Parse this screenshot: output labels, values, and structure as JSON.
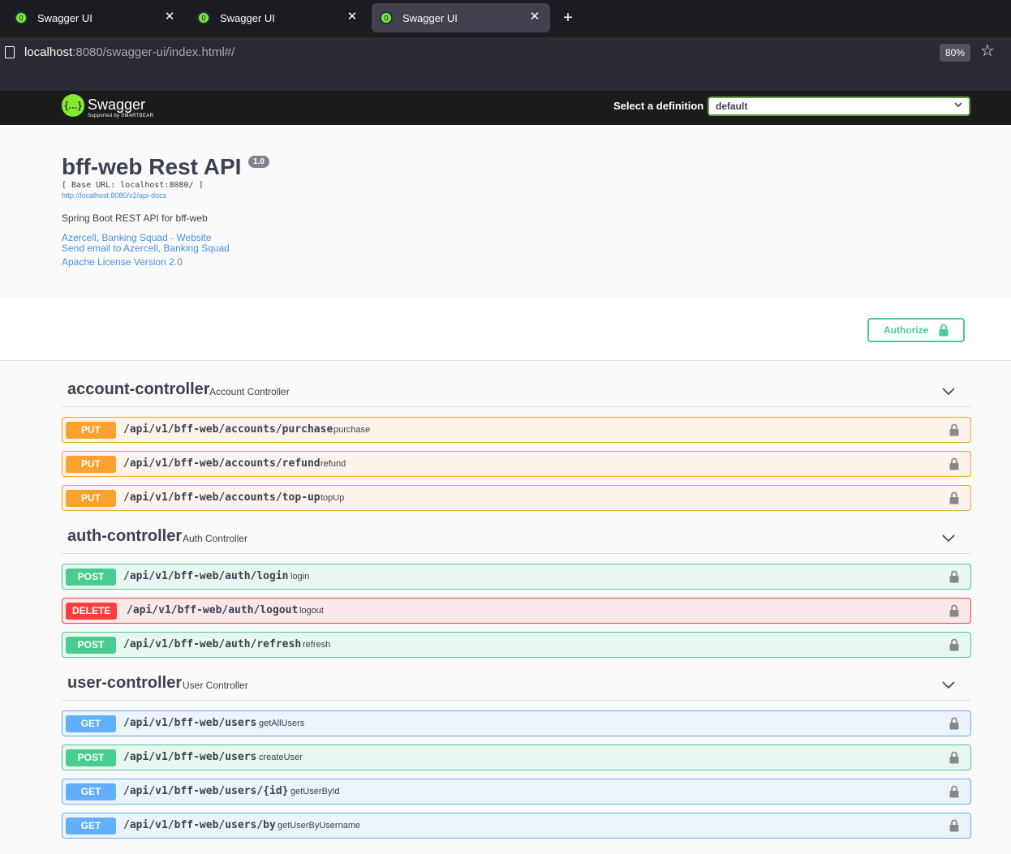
{
  "browser": {
    "tabs": [
      {
        "title": "Swagger UI"
      },
      {
        "title": "Swagger UI"
      },
      {
        "title": "Swagger UI",
        "active": true
      }
    ],
    "url_host": "localhost",
    "url_path": ":8080/swagger-ui/index.html#/",
    "zoom": "80%",
    "new_tab": "+",
    "close_glyph": "✕",
    "star_glyph": "☆"
  },
  "topbar": {
    "logo_text": "Swagger",
    "logo_sub": "Supported by SMARTBEAR",
    "definition_label": "Select a definition",
    "definition_value": "default",
    "chevron": "⌄"
  },
  "info": {
    "title": "bff-web Rest API",
    "version": "1.0",
    "base_url": "[ Base URL: localhost:8080/ ]",
    "api_docs_link": "http://localhost:8080/v2/api-docs",
    "description": "Spring Boot REST API for bff-web",
    "links": [
      "Azercell, Banking Squad - Website",
      "Send email to Azercell, Banking Squad",
      "Apache License Version 2.0"
    ]
  },
  "authorize_label": "Authorize",
  "tags": [
    {
      "name": "account-controller",
      "description": "Account Controller",
      "operations": [
        {
          "method": "PUT",
          "path": "/api/v1/bff-web/accounts/purchase",
          "summary": "purchase"
        },
        {
          "method": "PUT",
          "path": "/api/v1/bff-web/accounts/refund",
          "summary": "refund"
        },
        {
          "method": "PUT",
          "path": "/api/v1/bff-web/accounts/top-up",
          "summary": "topUp"
        }
      ]
    },
    {
      "name": "auth-controller",
      "description": "Auth Controller",
      "operations": [
        {
          "method": "POST",
          "path": "/api/v1/bff-web/auth/login",
          "summary": "login"
        },
        {
          "method": "DELETE",
          "path": "/api/v1/bff-web/auth/logout",
          "summary": "logout"
        },
        {
          "method": "POST",
          "path": "/api/v1/bff-web/auth/refresh",
          "summary": "refresh"
        }
      ]
    },
    {
      "name": "user-controller",
      "description": "User Controller",
      "operations": [
        {
          "method": "GET",
          "path": "/api/v1/bff-web/users",
          "summary": "getAllUsers"
        },
        {
          "method": "POST",
          "path": "/api/v1/bff-web/users",
          "summary": "createUser"
        },
        {
          "method": "GET",
          "path": "/api/v1/bff-web/users/{id}",
          "summary": "getUserById"
        },
        {
          "method": "GET",
          "path": "/api/v1/bff-web/users/by",
          "summary": "getUserByUsername"
        }
      ]
    }
  ],
  "colors": {
    "put": "#fca130",
    "post": "#49cc90",
    "delete": "#f93e3e",
    "get": "#61affe",
    "link": "#4990e2",
    "topbar": "#1b1b1b"
  }
}
